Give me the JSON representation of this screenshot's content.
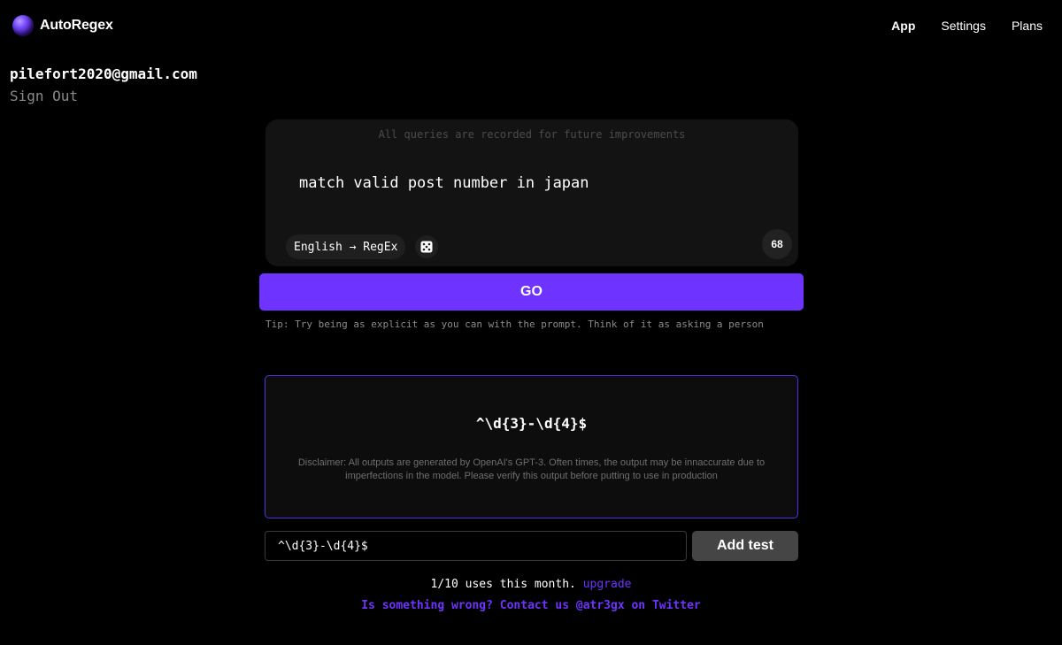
{
  "nav": {
    "brand": "AutoRegex",
    "links": [
      {
        "label": "App",
        "active": true
      },
      {
        "label": "Settings",
        "active": false
      },
      {
        "label": "Plans",
        "active": false
      }
    ]
  },
  "user": {
    "email": "pilefort2020@gmail.com",
    "sign_out": "Sign Out"
  },
  "query": {
    "record_note": "All queries are recorded for future improvements",
    "value": "match valid post number in japan",
    "mode": "English → RegEx",
    "random_icon": "dice-icon",
    "char_count": "68"
  },
  "go_button": "GO",
  "tip": "Tip: Try being as explicit as you can with the prompt. Think of it as asking a person",
  "result": {
    "regex": "^\\d{3}-\\d{4}$",
    "disclaimer": "Disclaimer: All outputs are generated by OpenAI's GPT-3. Often times, the output may be innaccurate due to imperfections in the model. Please verify this output before putting to use in production"
  },
  "test": {
    "value": "^\\d{3}-\\d{4}$",
    "add_label": "Add test"
  },
  "footer": {
    "usage": "1/10 uses this month.",
    "upgrade": "upgrade",
    "contact": "Is something wrong? Contact us @atr3gx on Twitter"
  },
  "colors": {
    "accent": "#6f33ff",
    "background": "#000000",
    "card": "#131313",
    "muted_text": "#8b8b8b"
  }
}
